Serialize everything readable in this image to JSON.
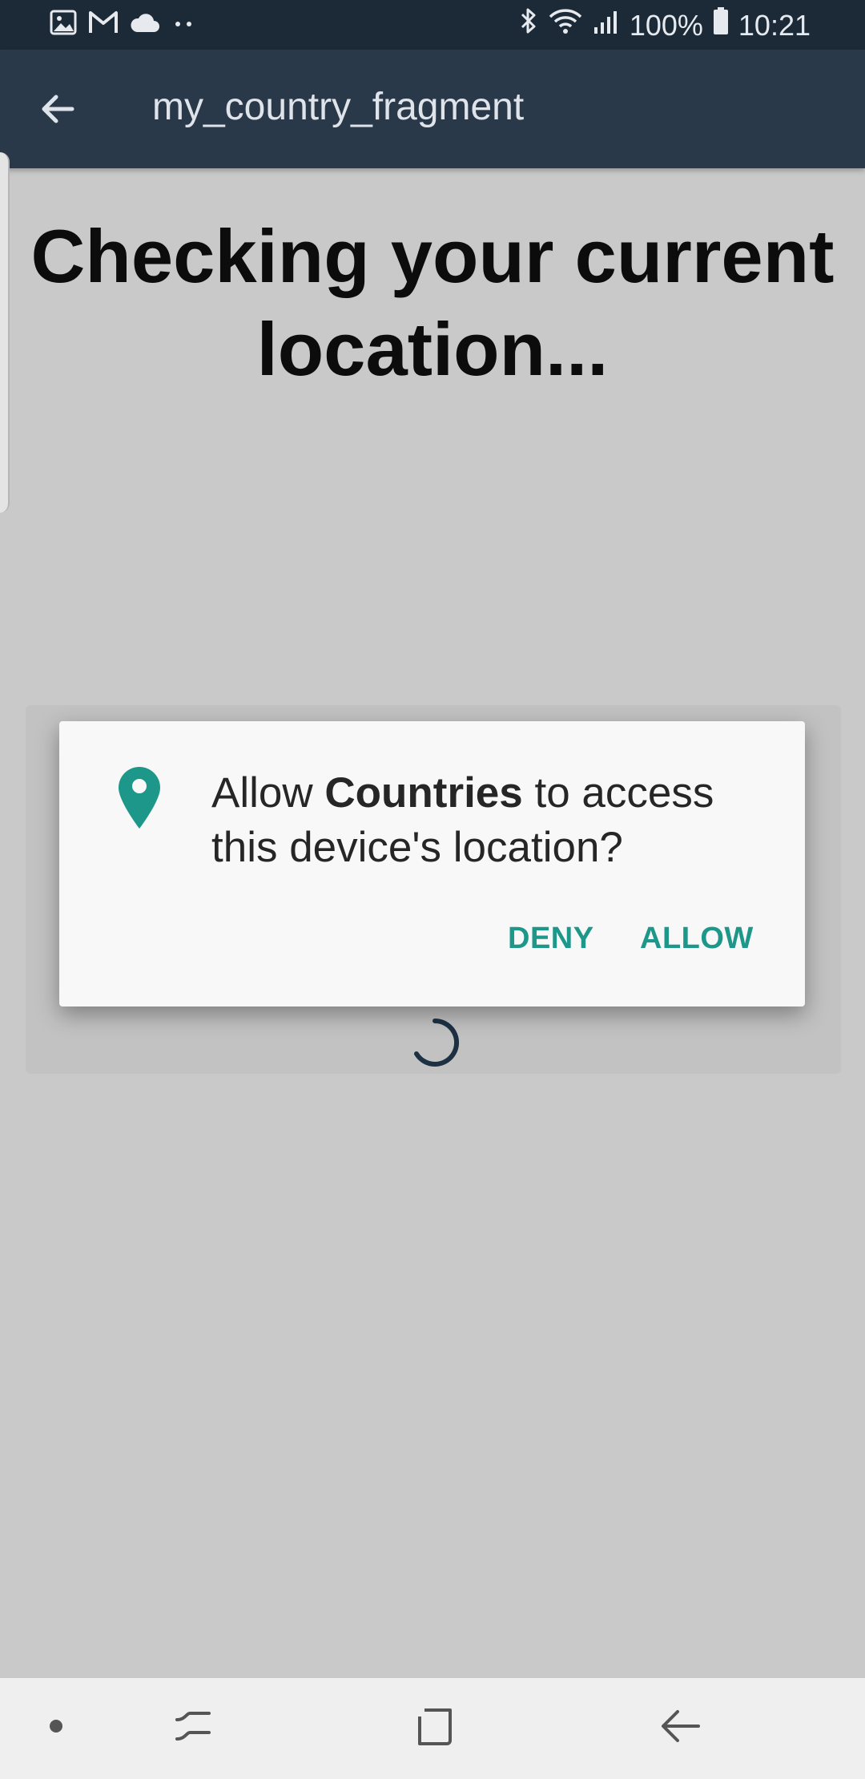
{
  "status_bar": {
    "icons_left": [
      "image-icon",
      "gmail-icon",
      "cloud-icon",
      "more-dots-icon"
    ],
    "icons_right": [
      "bluetooth-icon",
      "wifi-icon",
      "signal-icon"
    ],
    "battery_text": "100%",
    "time": "10:21"
  },
  "app_bar": {
    "title": "my_country_fragment"
  },
  "main": {
    "heading": "Checking your current location..."
  },
  "dialog": {
    "message_prefix": "Allow ",
    "app_name": "Countries",
    "message_suffix": " to access this device's location?",
    "deny_label": "DENY",
    "allow_label": "ALLOW",
    "accent_color": "#1c978a"
  },
  "nav_bar": {
    "icons": [
      "dot-icon",
      "recents-icon",
      "home-icon",
      "back-icon"
    ]
  }
}
